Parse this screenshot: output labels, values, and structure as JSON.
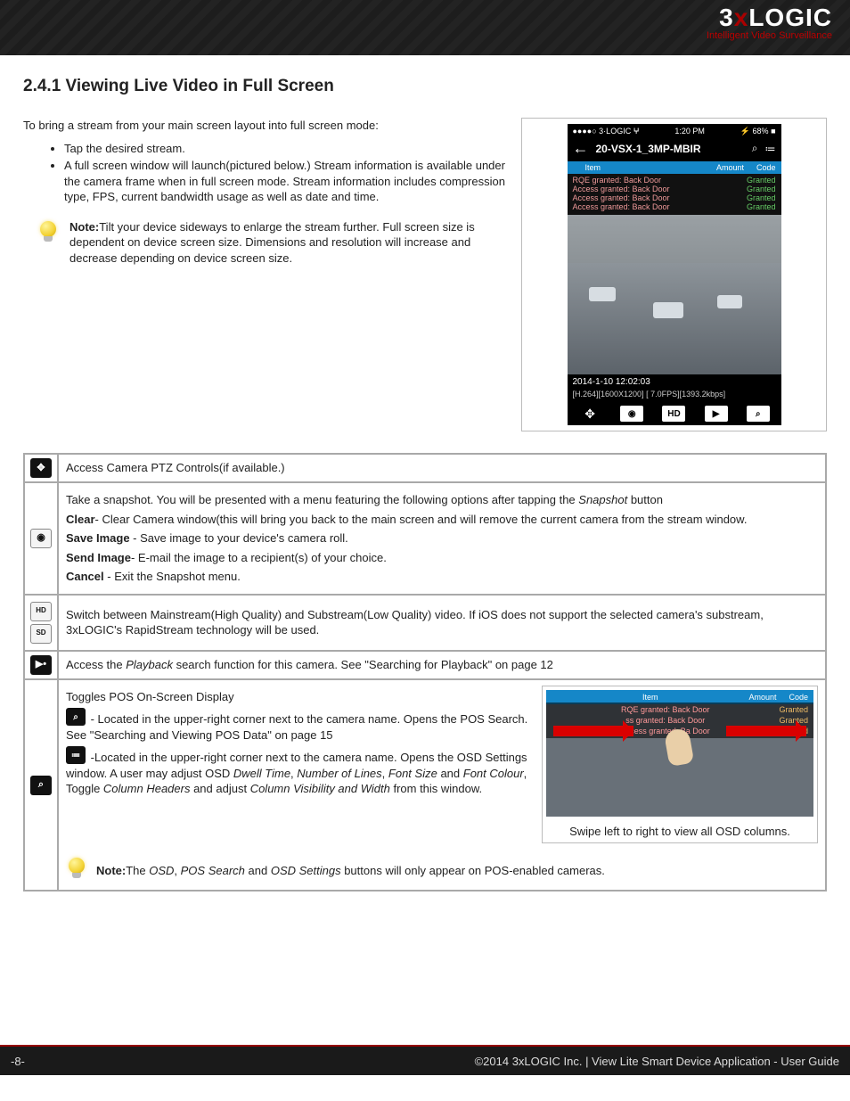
{
  "brand": {
    "main_pre": "3",
    "main_x": "x",
    "main_post": "LOGIC",
    "sub": "Intelligent Video Surveillance"
  },
  "section_number": "2.4.1",
  "section_title": "Viewing Live Video in Full Screen",
  "intro": "To bring a stream from your main screen layout into full screen mode:",
  "bullets": {
    "b1": "Tap the desired stream.",
    "b2": "A full screen window will launch(pictured below.) Stream information is available under the camera frame when in full screen mode. Stream information includes compression type, FPS, current bandwidth usage as well as date and time."
  },
  "note1_label": "Note:",
  "note1_text": "Tilt your device sideways to enlarge the stream further. Full screen size is dependent on device screen size. Dimensions and resolution will increase and decrease depending on device screen size.",
  "phone": {
    "status_left": "●●●●○ 3·LOGIC ⵖ",
    "time": "1:20 PM",
    "status_right": "⚡ 68% ■",
    "title": "20-VSX-1_3MP-MBIR",
    "osd_head": {
      "c1": "Item",
      "c2": "Amount",
      "c3": "Code"
    },
    "rows": [
      {
        "ev": "RQE granted: Back Door",
        "st": "Granted"
      },
      {
        "ev": "Access granted: Back Door",
        "st": "Granted"
      },
      {
        "ev": "Access granted: Back Door",
        "st": "Granted"
      },
      {
        "ev": "Access granted: Back Door",
        "st": "Granted"
      }
    ],
    "timestamp": "2014-1-10 12:02:03",
    "info": "[H.264][1600X1200] [ 7.0FPS][1393.2kbps]"
  },
  "functable": {
    "r1": {
      "icon": "✥",
      "text": "Access Camera PTZ Controls(if available.)"
    },
    "r2": {
      "icon": "📷",
      "p1_a": "Take a snapshot. You will be presented with a menu featuring the following options after tapping the ",
      "p1_i": "Snapshot",
      "p1_b": " button",
      "clear_b": "Clear",
      "clear_t": "- Clear Camera window(this will bring you back to the main screen and will remove the current camera from the stream window.",
      "save_b": "Save Image",
      "save_t": " - Save image to your device's camera roll.",
      "send_b": "Send Image",
      "send_t": "- E-mail the image to a recipient(s) of your choice.",
      "cancel_b": "Cancel",
      "cancel_t": " - Exit the Snapshot menu."
    },
    "r3": {
      "icon_hd": "HD",
      "icon_sd": "SD",
      "text": "Switch between Mainstream(High Quality) and Substream(Low Quality) video. If iOS does not support the selected camera's substream, 3xLOGIC's RapidStream technology will be used."
    },
    "r4": {
      "icon": "▶•",
      "t1": "Access the ",
      "ti": "Playback ",
      "t2": " search function for this camera. See \"Searching for Playback\" on page 12"
    },
    "r5": {
      "icon": "⌕",
      "title": "Toggles POS On-Screen Display",
      "ic1": "⌕",
      "p1": " - Located in the upper-right corner next to the camera name. Opens the POS Search. See \"Searching and Viewing POS Data\" on page 15",
      "ic2": "≔",
      "p2a": " -Located in the upper-right corner next to the camera name. Opens the OSD Settings window. A user may adjust OSD ",
      "p2i1": "Dwell Time",
      "p2c1": ", ",
      "p2i2": "Number of Lines",
      "p2c2": ", ",
      "p2i3": "Font Size",
      "p2c3": " and ",
      "p2i4": "Font Colour",
      "p2c4": ", Toggle ",
      "p2i5": "Column Headers",
      "p2c5": " and adjust ",
      "p2i6": "Column Visibility and Width",
      "p2c6": " from this window.",
      "thumb_caption": "Swipe left to right to view all OSD columns.",
      "thumb_head": {
        "c1": "Item",
        "c2": "Amount",
        "c3": "Code"
      },
      "thumb_rows": [
        {
          "e": "RQE granted: Back Door",
          "s": "Granted"
        },
        {
          "e": "ss granted: Back Door",
          "s": "Granted"
        },
        {
          "e": "Access granted: Ba Door",
          "s": "Granted"
        }
      ],
      "note_b": "Note:",
      "note_t1": "The ",
      "note_i1": "OSD",
      "note_c1": ", ",
      "note_i2": "POS Search",
      "note_c2": " and ",
      "note_i3": "OSD Settings",
      "note_t2": " buttons will only appear on POS-enabled cameras."
    }
  },
  "footer": {
    "page": "-8-",
    "right": "©2014 3xLOGIC Inc.  |  View Lite Smart Device Application - User  Guide"
  }
}
